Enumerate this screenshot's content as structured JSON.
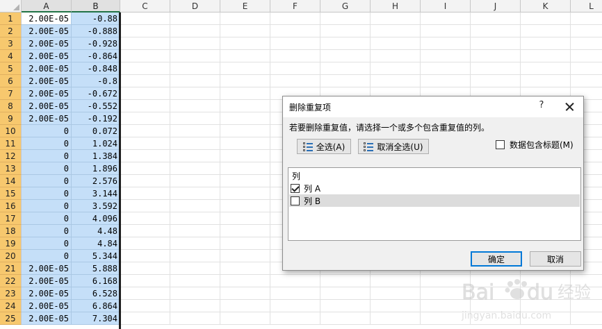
{
  "sheet": {
    "columns": [
      "A",
      "B",
      "C",
      "D",
      "E",
      "F",
      "G",
      "H",
      "I",
      "J",
      "K",
      "L"
    ],
    "rows": [
      {
        "n": "1",
        "a": "2.00E-05",
        "b": "-0.88"
      },
      {
        "n": "2",
        "a": "2.00E-05",
        "b": "-0.888"
      },
      {
        "n": "3",
        "a": "2.00E-05",
        "b": "-0.928"
      },
      {
        "n": "4",
        "a": "2.00E-05",
        "b": "-0.864"
      },
      {
        "n": "5",
        "a": "2.00E-05",
        "b": "-0.848"
      },
      {
        "n": "6",
        "a": "2.00E-05",
        "b": "-0.8"
      },
      {
        "n": "7",
        "a": "2.00E-05",
        "b": "-0.672"
      },
      {
        "n": "8",
        "a": "2.00E-05",
        "b": "-0.552"
      },
      {
        "n": "9",
        "a": "2.00E-05",
        "b": "-0.192"
      },
      {
        "n": "10",
        "a": "0",
        "b": "0.072"
      },
      {
        "n": "11",
        "a": "0",
        "b": "1.024"
      },
      {
        "n": "12",
        "a": "0",
        "b": "1.384"
      },
      {
        "n": "13",
        "a": "0",
        "b": "1.896"
      },
      {
        "n": "14",
        "a": "0",
        "b": "2.576"
      },
      {
        "n": "15",
        "a": "0",
        "b": "3.144"
      },
      {
        "n": "16",
        "a": "0",
        "b": "3.592"
      },
      {
        "n": "17",
        "a": "0",
        "b": "4.096"
      },
      {
        "n": "18",
        "a": "0",
        "b": "4.48"
      },
      {
        "n": "19",
        "a": "0",
        "b": "4.84"
      },
      {
        "n": "20",
        "a": "0",
        "b": "5.344"
      },
      {
        "n": "21",
        "a": "2.00E-05",
        "b": "5.888"
      },
      {
        "n": "22",
        "a": "2.00E-05",
        "b": "6.168"
      },
      {
        "n": "23",
        "a": "2.00E-05",
        "b": "6.528"
      },
      {
        "n": "24",
        "a": "2.00E-05",
        "b": "6.864"
      },
      {
        "n": "25",
        "a": "2.00E-05",
        "b": "7.304"
      }
    ]
  },
  "dialog": {
    "title": "删除重复项",
    "help_label": "?",
    "instruction": "若要删除重复值，请选择一个或多个包含重复值的列。",
    "select_all_label": "全选(A)",
    "unselect_all_label": "取消全选(U)",
    "has_headers_label": "数据包含标题(M)",
    "has_headers_checked": false,
    "column_list_header": "列",
    "columns": [
      {
        "label": "列 A",
        "checked": true
      },
      {
        "label": "列 B",
        "checked": false
      }
    ],
    "ok_label": "确定",
    "cancel_label": "取消"
  },
  "watermark": {
    "brand": "Bai du 经验",
    "url": "jingyan.baidu.com"
  },
  "colors": {
    "selection": "#c5dff8",
    "row_header_selected": "#f7c86e",
    "dialog_bg": "#f0f0f0",
    "default_button_border": "#0078d7"
  }
}
